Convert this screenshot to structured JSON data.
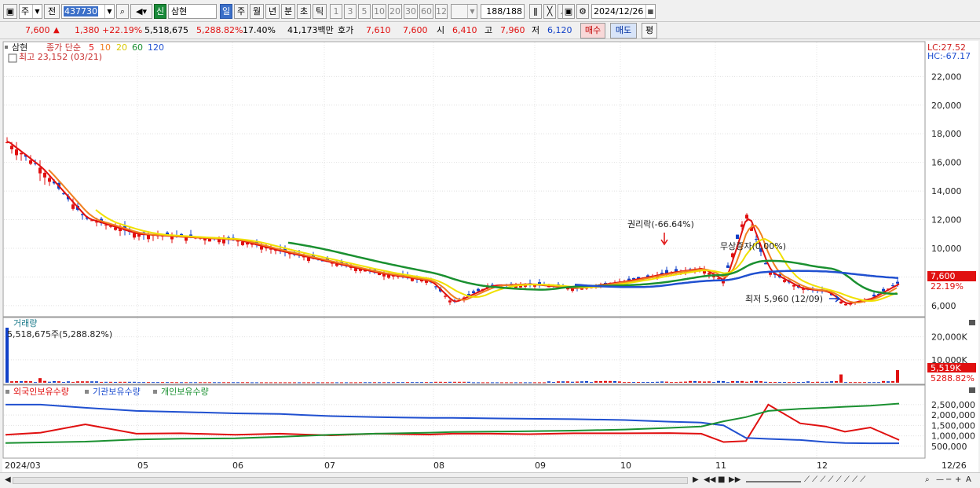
{
  "toolbar": {
    "type_label": "주",
    "prev_label": "전",
    "code": "437730",
    "badge": "신",
    "stock_name": "삼현",
    "periods": [
      "일",
      "주",
      "월",
      "년",
      "분",
      "초",
      "틱"
    ],
    "minutes": [
      "1",
      "3",
      "5",
      "10",
      "20",
      "30",
      "60",
      "120"
    ],
    "count": "188",
    "count_total": "/188",
    "date": "2024/12/26"
  },
  "quote": {
    "price": "7,600",
    "arrow": "▲",
    "change": "1,380",
    "change_pct": "+22.19%",
    "volume": "5,518,675",
    "volume_pct": "5,288.82%",
    "turnover": "17.40%",
    "amount": "41,173백만",
    "hoga_label": "호가",
    "ask": "7,610",
    "bid": "7,600",
    "open_label": "시",
    "open": "6,410",
    "high_label": "고",
    "high": "7,960",
    "low_label": "저",
    "low": "6,120",
    "buy_label": "매수",
    "sell_label": "매도",
    "eval_label": "평"
  },
  "price_panel": {
    "name": "삼현",
    "ma_label": "종가 단순",
    "ma_periods": [
      {
        "p": "5",
        "color": "#e01010"
      },
      {
        "p": "10",
        "color": "#f08020"
      },
      {
        "p": "20",
        "color": "#d8c800"
      },
      {
        "p": "60",
        "color": "#1a9030"
      },
      {
        "p": "120",
        "color": "#2050d0"
      }
    ],
    "max_label": "최고 23,152 (03/21)",
    "min_label": "최저 5,960 (12/09)",
    "annot_rights": "권리락(-66.64%)",
    "annot_bonus": "무상증자(0.00%)",
    "lc": "LC:27.52",
    "hc": "HC:-67.17",
    "yticks": [
      "22,000",
      "20,000",
      "18,000",
      "16,000",
      "14,000",
      "12,000",
      "10,000",
      "8,000",
      "6,000"
    ],
    "last_price": "7,600",
    "last_pct": "22.19%"
  },
  "volume_panel": {
    "title": "거래량",
    "value": "5,518,675주(5,288.82%)",
    "yticks": [
      "20,000K",
      "10,000K"
    ],
    "last_value": "5,519K",
    "last_pct": "5288.82%"
  },
  "holding_panel": {
    "legend": [
      {
        "label": "외국인보유수량",
        "color": "#e01010"
      },
      {
        "label": "기관보유수량",
        "color": "#2050d0"
      },
      {
        "label": "개인보유수량",
        "color": "#1a9030"
      }
    ],
    "yticks": [
      "2,500,000",
      "2,000,000",
      "1,500,000",
      "1,000,000",
      "500,000"
    ]
  },
  "xaxis": {
    "labels": [
      "2024/03",
      "05",
      "06",
      "07",
      "08",
      "09",
      "10",
      "11",
      "12"
    ],
    "last": "12/26"
  },
  "colors": {
    "up": "#e01010",
    "down": "#1040c8",
    "ma5": "#e01010",
    "ma10": "#f08020",
    "ma20": "#f0e000",
    "ma60": "#1a9030",
    "ma120": "#2050d0"
  },
  "chart_data": {
    "type": "line",
    "x": [
      "2024-03-21",
      "2024-04-01",
      "2024-04-15",
      "2024-05-01",
      "2024-05-15",
      "2024-06-01",
      "2024-06-15",
      "2024-07-01",
      "2024-07-15",
      "2024-08-01",
      "2024-08-08",
      "2024-08-20",
      "2024-09-01",
      "2024-09-15",
      "2024-10-01",
      "2024-10-15",
      "2024-10-25",
      "2024-11-01",
      "2024-11-08",
      "2024-11-15",
      "2024-11-25",
      "2024-12-03",
      "2024-12-09",
      "2024-12-17",
      "2024-12-26"
    ],
    "series": [
      {
        "name": "종가",
        "values": [
          17500,
          15600,
          12100,
          11000,
          10800,
          10600,
          9800,
          9000,
          8300,
          7700,
          6200,
          7400,
          7500,
          7200,
          7700,
          8300,
          8600,
          7700,
          12500,
          8400,
          7200,
          7000,
          6100,
          6500,
          7600
        ]
      }
    ],
    "ylim": [
      5500,
      23500
    ],
    "volume_ylim": [
      0,
      24000
    ],
    "holding_ylim": [
      0,
      2800000
    ],
    "holding_series": [
      {
        "name": "외국인보유수량",
        "values": [
          1050000,
          1150000,
          1550000,
          1100000,
          1120000,
          1050000,
          1100000,
          1020000,
          1100000,
          1060000,
          1100000,
          1100000,
          1080000,
          1120000,
          1120000,
          1130000,
          1100000,
          700000,
          750000,
          2500000,
          1600000,
          1450000,
          1200000,
          1400000,
          800000
        ]
      },
      {
        "name": "기관보유수량",
        "values": [
          2500000,
          2500000,
          2350000,
          2200000,
          2150000,
          2080000,
          2050000,
          1950000,
          1900000,
          1860000,
          1860000,
          1840000,
          1820000,
          1800000,
          1760000,
          1680000,
          1640000,
          1500000,
          900000,
          850000,
          800000,
          700000,
          650000,
          640000,
          640000
        ]
      },
      {
        "name": "개인보유수량",
        "values": [
          650000,
          680000,
          720000,
          820000,
          860000,
          880000,
          950000,
          1050000,
          1100000,
          1150000,
          1180000,
          1200000,
          1220000,
          1250000,
          1300000,
          1380000,
          1450000,
          1700000,
          1900000,
          2200000,
          2300000,
          2350000,
          2400000,
          2450000,
          2550000
        ]
      }
    ],
    "volume_values": [
      24000,
      2000,
      600,
      400,
      300,
      250,
      250,
      200,
      200,
      200,
      250,
      300,
      400,
      200,
      200,
      600,
      1200,
      350,
      9200,
      1100,
      900,
      350,
      3600,
      300,
      5519
    ]
  }
}
